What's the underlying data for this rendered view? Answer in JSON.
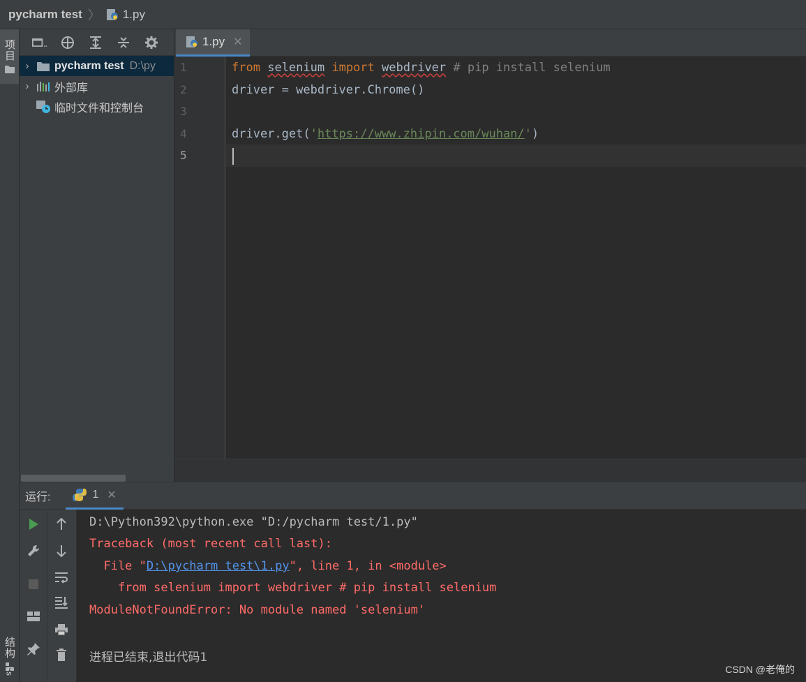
{
  "titlebar": {
    "project": "pycharm test",
    "file": "1.py"
  },
  "leftstrip": {
    "project_tab": "项目",
    "structure_tab": "结构",
    "bottom_tab": "ks"
  },
  "project_panel": {
    "items": [
      {
        "label": "pycharm test",
        "path": "D:\\py"
      },
      {
        "label": "外部库"
      },
      {
        "label": "临时文件和控制台"
      }
    ]
  },
  "editor": {
    "tab_label": "1.py",
    "line_numbers": [
      "1",
      "2",
      "3",
      "4",
      "5"
    ],
    "lines": {
      "l1": {
        "from": "from",
        "mod": "selenium",
        "imp": "import",
        "name": "webdriver",
        "comment": "# pip install selenium"
      },
      "l2": "driver = webdriver.Chrome()",
      "l4": {
        "pre": "driver.get(",
        "q1": "'",
        "url": "https://www.zhipin.com/wuhan/",
        "q2": "'",
        "post": ")"
      }
    }
  },
  "run": {
    "label": "运行:",
    "tab_label": "1",
    "console": {
      "cmd": "D:\\Python392\\python.exe \"D:/pycharm test/1.py\"",
      "traceback": "Traceback (most recent call last):",
      "file_pre": "  File \"",
      "file_link": "D:\\pycharm test\\1.py",
      "file_post": "\", line 1, in <module>",
      "code": "    from selenium import webdriver # pip install selenium",
      "error": "ModuleNotFoundError: No module named 'selenium'",
      "exit": "进程已结束,退出代码1"
    }
  },
  "watermark": "CSDN @老俺的"
}
